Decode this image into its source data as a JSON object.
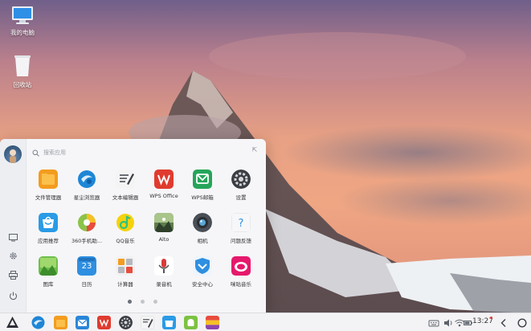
{
  "desktop": {
    "icons": [
      {
        "label": "我的电脑",
        "icon": "computer-icon"
      },
      {
        "label": "回收站",
        "icon": "recycle-bin-icon"
      }
    ]
  },
  "launcher": {
    "search_placeholder": "搜索应用",
    "rail": {
      "avatar": "user-avatar",
      "buttons": [
        "monitor-icon",
        "settings-gear-icon",
        "printer-icon",
        "power-icon"
      ]
    },
    "apps": [
      {
        "label": "文件管理器",
        "icon": "folder-icon",
        "color": "#f6a623"
      },
      {
        "label": "星尘浏览器",
        "icon": "browser-icon",
        "color": "#1e88d8"
      },
      {
        "label": "文本编辑器",
        "icon": "text-editor-icon",
        "color": "#ffffff"
      },
      {
        "label": "WPS Office",
        "icon": "wps-office-icon",
        "color": "#e53935"
      },
      {
        "label": "WPS邮箱",
        "icon": "wps-mail-icon",
        "color": "#27ae60"
      },
      {
        "label": "设置",
        "icon": "settings-icon",
        "color": "#3a3d42"
      },
      {
        "label": "应用推荐",
        "icon": "app-store-icon",
        "color": "#2f9ee8"
      },
      {
        "label": "360手机助...",
        "icon": "360-assistant-icon",
        "color": "#8bc34a"
      },
      {
        "label": "QQ音乐",
        "icon": "qq-music-icon",
        "color": "#f4d21f"
      },
      {
        "label": "Alto",
        "icon": "alto-icon",
        "color": "#3d5a3a"
      },
      {
        "label": "相机",
        "icon": "camera-icon",
        "color": "#4a4f57"
      },
      {
        "label": "问题反馈",
        "icon": "feedback-icon",
        "color": "#ffffff"
      },
      {
        "label": "图库",
        "icon": "gallery-icon",
        "color": "#6abf4b"
      },
      {
        "label": "日历",
        "icon": "calendar-icon",
        "color": "#2f8fe0"
      },
      {
        "label": "计算器",
        "icon": "calculator-icon",
        "color": "#f2f2f2"
      },
      {
        "label": "录音机",
        "icon": "recorder-icon",
        "color": "#ffffff"
      },
      {
        "label": "安全中心",
        "icon": "security-center-icon",
        "color": "#2f8fe0"
      },
      {
        "label": "咪咕音乐",
        "icon": "migu-music-icon",
        "color": "#e91e63"
      }
    ],
    "calendar_day": "23",
    "page_dots": 3,
    "active_page": 1
  },
  "taskbar": {
    "apps": [
      "start-menu-icon",
      "browser-icon",
      "folder-icon",
      "mail-icon",
      "wps-office-icon",
      "settings-icon",
      "text-editor-icon",
      "app-store-icon",
      "android-icon",
      "gallery-icon"
    ],
    "tray": [
      "keyboard-icon",
      "volume-icon",
      "wifi-icon",
      "battery-icon"
    ],
    "clock": "13:27",
    "nav": [
      "back-icon",
      "home-icon"
    ]
  }
}
